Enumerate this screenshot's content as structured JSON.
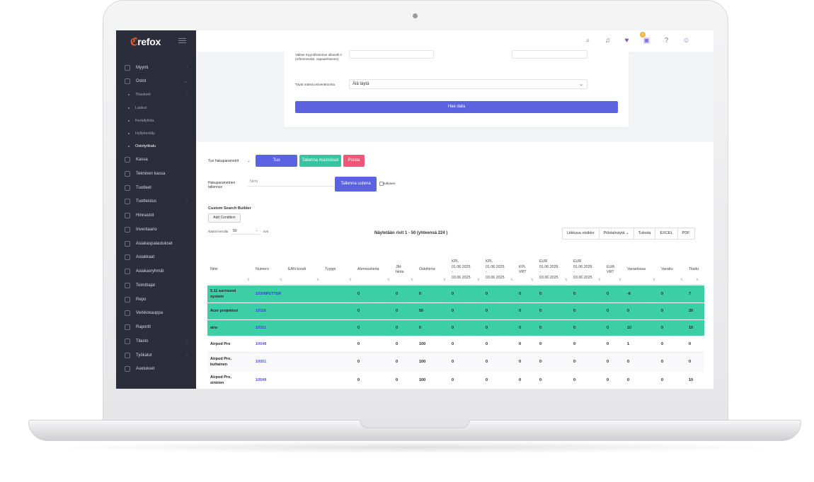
{
  "sidebar": {
    "logo": "refox",
    "items": [
      {
        "label": "Myynti",
        "chevron": "›",
        "type": "item"
      },
      {
        "label": "Ostot",
        "chevron": "⌄",
        "type": "item"
      },
      {
        "label": "Tilaukset",
        "chevron": "›",
        "type": "sub"
      },
      {
        "label": "Laskut",
        "chevron": "›",
        "type": "sub"
      },
      {
        "label": "Keräilylista",
        "chevron": "",
        "type": "sub"
      },
      {
        "label": "Hyllykeräily",
        "chevron": "",
        "type": "sub"
      },
      {
        "label": "Ostotyökalu",
        "chevron": "",
        "type": "sub",
        "active": true
      },
      {
        "label": "Kassa",
        "chevron": "",
        "type": "item"
      },
      {
        "label": "Tekninen kassa",
        "chevron": "",
        "type": "item"
      },
      {
        "label": "Tuotteet",
        "chevron": "",
        "type": "item"
      },
      {
        "label": "Tuotteistus",
        "chevron": "›",
        "type": "item"
      },
      {
        "label": "Hinnastot",
        "chevron": "",
        "type": "item"
      },
      {
        "label": "Inventaario",
        "chevron": "",
        "type": "item"
      },
      {
        "label": "Asiakaspalautukset",
        "chevron": "",
        "type": "item"
      },
      {
        "label": "Asiakkaat",
        "chevron": "",
        "type": "item"
      },
      {
        "label": "Asiakasryhmät",
        "chevron": "",
        "type": "item"
      },
      {
        "label": "Toimittajat",
        "chevron": "",
        "type": "item"
      },
      {
        "label": "Repo",
        "chevron": "",
        "type": "item"
      },
      {
        "label": "Verkkokauppa",
        "chevron": "",
        "type": "item"
      },
      {
        "label": "Raportit",
        "chevron": "",
        "type": "item"
      },
      {
        "label": "Tilasto",
        "chevron": "›",
        "type": "item"
      },
      {
        "label": "Työkalut",
        "chevron": "›",
        "type": "item"
      },
      {
        "label": "Asetukset",
        "chevron": "",
        "type": "item"
      }
    ]
  },
  "topbar": {
    "icons": [
      "search-icon",
      "bell-icon",
      "heart-icon",
      "gift-icon",
      "help-icon",
      "user-icon"
    ],
    "notif_count": "1",
    "accent": "#8a6fd8"
  },
  "form": {
    "history_label": "Valitse myyntihistorian alkaväli 2 (referenssiksi, vapaaehtoinen)",
    "fill_label": "Täytä määrä ostoeräkoosta",
    "fill_value": "Älä täytä",
    "fetch_button": "Hae data"
  },
  "search": {
    "import_label": "Tuo hakuparametrit",
    "import_button": "Tuo",
    "save_changes_button": "Tallenna muutokset",
    "delete_button": "Poista",
    "save_params_label": "Hakuparametrien tallennus",
    "name_placeholder": "Nimi",
    "save_new_button": "Tallenna uutena",
    "public_label": "Julkinen",
    "builder_title": "Custom Search Builder",
    "add_condition": "Add Condition"
  },
  "table_controls": {
    "show_label": "Näytä kerralla",
    "show_value": "50",
    "rows_label": "rivit",
    "range": "Näytetään rivit 1 - 50 (yhteensä 224 )",
    "tools": [
      "Liikkuva otsikko",
      "Piilota/näytä ⌄",
      "Tulosta",
      "EXCEL",
      "PDF"
    ]
  },
  "table": {
    "headers": [
      [
        "Nimi"
      ],
      [
        "Numero"
      ],
      [
        "EAN koodi"
      ],
      [
        "Tyyppi"
      ],
      [
        "Alennushinta"
      ],
      [
        "JM-",
        "hinta"
      ],
      [
        "Ostohinta"
      ],
      [
        "KPL",
        "01.06.2025",
        "-",
        "03.06.2025"
      ],
      [
        "KPL",
        "01.06.2025",
        "-",
        "03.06.2025"
      ],
      [
        "KPL",
        "VRT"
      ],
      [
        "EUR",
        "01.06.2025",
        "-",
        "03.06.2025"
      ],
      [
        "EUR",
        "01.06.2025",
        "-",
        "03.06.2025"
      ],
      [
        "EUR",
        "VRT"
      ],
      [
        "Varastossa"
      ],
      [
        "Varattu"
      ],
      [
        "Tilattu"
      ]
    ],
    "rows": [
      {
        "style": "green",
        "name": [
          "5.11 surround",
          "system"
        ],
        "number": "102HIPETTER",
        "cells": [
          "0",
          "0",
          "0",
          "0",
          "0",
          "0",
          "0",
          "0",
          "0",
          "-6",
          "0",
          "7"
        ]
      },
      {
        "style": "green",
        "name": [
          "Acer projektori"
        ],
        "number": "10116",
        "cells": [
          "0",
          "0",
          "50",
          "0",
          "0",
          "0",
          "0",
          "0",
          "0",
          "0",
          "0",
          "20"
        ]
      },
      {
        "style": "green",
        "name": [
          "airo"
        ],
        "number": "10211",
        "cells": [
          "0",
          "0",
          "0",
          "0",
          "0",
          "0",
          "0",
          "0",
          "0",
          "10",
          "0",
          "10"
        ]
      },
      {
        "style": "white",
        "name": [
          "Airpod Pro"
        ],
        "number": "10548",
        "cells": [
          "0",
          "0",
          "100",
          "0",
          "0",
          "0",
          "0",
          "0",
          "0",
          "1",
          "0",
          "0"
        ]
      },
      {
        "style": "alt",
        "name": [
          "Airpod Pro,",
          "kultainen"
        ],
        "number": "10551",
        "cells": [
          "0",
          "0",
          "100",
          "0",
          "0",
          "0",
          "0",
          "0",
          "0",
          "0",
          "0",
          "0"
        ]
      },
      {
        "style": "white",
        "name": [
          "Airpod Pro,",
          "sininen"
        ],
        "number": "10549",
        "cells": [
          "0",
          "0",
          "100",
          "0",
          "0",
          "0",
          "0",
          "0",
          "0",
          "0",
          "0",
          "10"
        ]
      }
    ]
  }
}
